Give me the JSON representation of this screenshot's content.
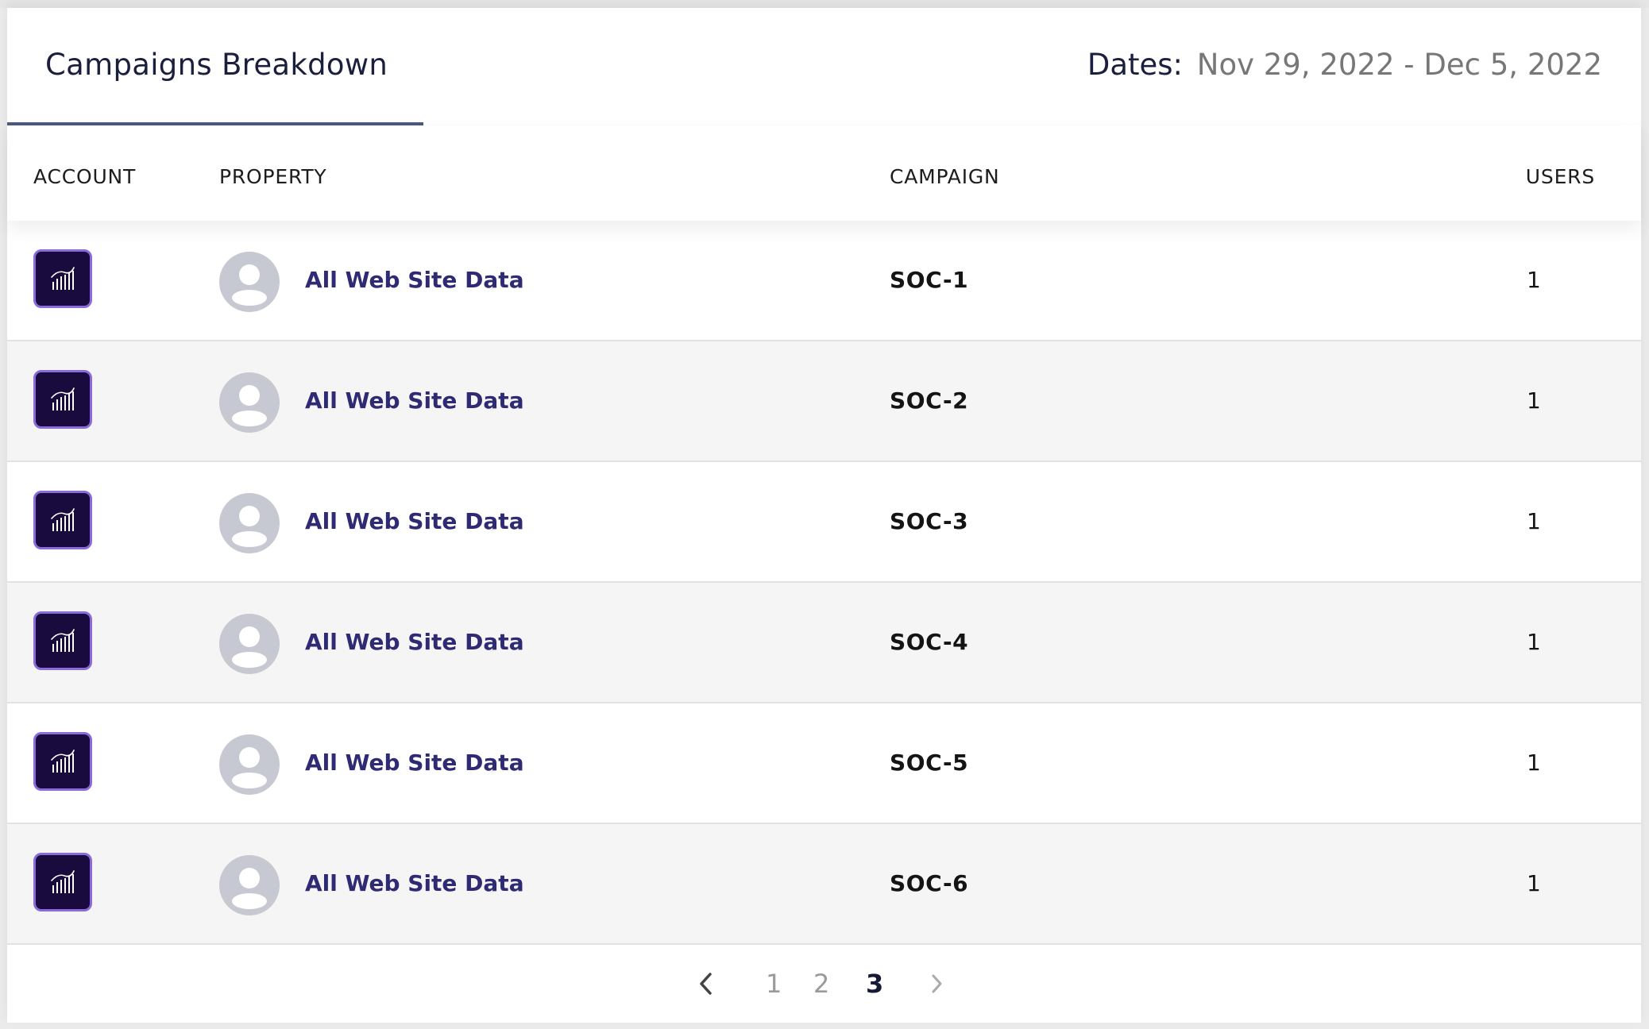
{
  "header": {
    "tab_title": "Campaigns Breakdown",
    "dates_label": "Dates:",
    "dates_value": "Nov 29, 2022 - Dec 5, 2022"
  },
  "columns": {
    "account": "ACCOUNT",
    "property": "PROPERTY",
    "campaign": "CAMPAIGN",
    "users": "USERS"
  },
  "rows": [
    {
      "property": "All Web Site Data",
      "campaign": "SOC-1",
      "users": "1"
    },
    {
      "property": "All Web Site Data",
      "campaign": "SOC-2",
      "users": "1"
    },
    {
      "property": "All Web Site Data",
      "campaign": "SOC-3",
      "users": "1"
    },
    {
      "property": "All Web Site Data",
      "campaign": "SOC-4",
      "users": "1"
    },
    {
      "property": "All Web Site Data",
      "campaign": "SOC-5",
      "users": "1"
    },
    {
      "property": "All Web Site Data",
      "campaign": "SOC-6",
      "users": "1"
    }
  ],
  "icons": {
    "account": "analytics-chart-icon",
    "avatar": "user-avatar-icon"
  },
  "colors": {
    "account_bg": "#1a0b3e",
    "account_border": "#8a6bdc",
    "link": "#2e2a73",
    "tab_underline": "#4a5a7c"
  },
  "pagination": {
    "prev": "‹",
    "pages": [
      "1",
      "2",
      "3"
    ],
    "current": "3",
    "next": "›"
  }
}
